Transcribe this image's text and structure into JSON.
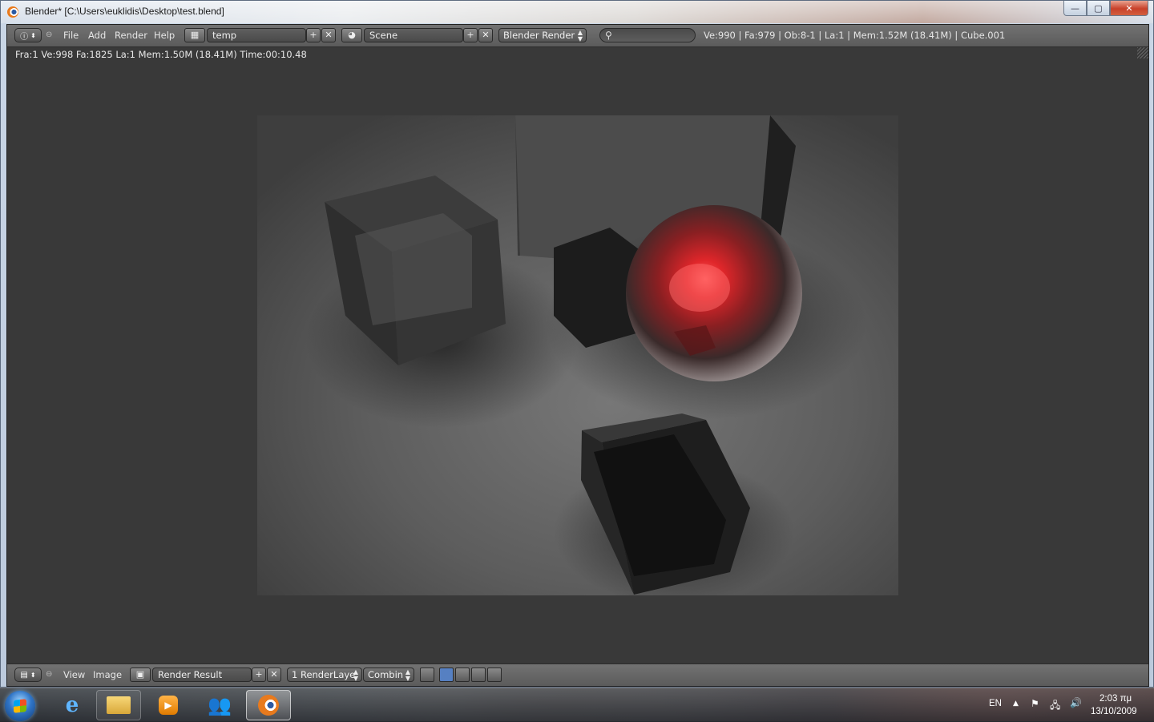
{
  "window": {
    "title": "Blender* [C:\\Users\\euklidis\\Desktop\\test.blend]",
    "minimize": "—",
    "maximize": "▢",
    "close": "✕"
  },
  "header": {
    "menus": [
      "File",
      "Add",
      "Render",
      "Help"
    ],
    "screen_layout": "temp",
    "scene": "Scene",
    "render_engine": "Blender Render",
    "search_placeholder": "",
    "stats": "Ve:990 | Fa:979 | Ob:8-1 | La:1 | Mem:1.52M (18.41M) | Cube.001"
  },
  "info_bar": {
    "text": "Fra:1  Ve:998 Fa:1825 La:1 Mem:1.50M (18.41M) Time:00:10.48"
  },
  "image_editor": {
    "menus": [
      "View",
      "Image"
    ],
    "image_name": "Render Result",
    "render_layer": "1 RenderLaye",
    "pass": "Combin"
  },
  "taskbar": {
    "apps": [
      "internet-explorer",
      "windows-explorer",
      "media-player",
      "messenger",
      "blender"
    ],
    "language": "EN",
    "time": "2:03 πμ",
    "date": "13/10/2009"
  },
  "colors": {
    "blender_bg": "#393939",
    "header": "#5b5b5b",
    "sphere_red": "#e0262a"
  }
}
